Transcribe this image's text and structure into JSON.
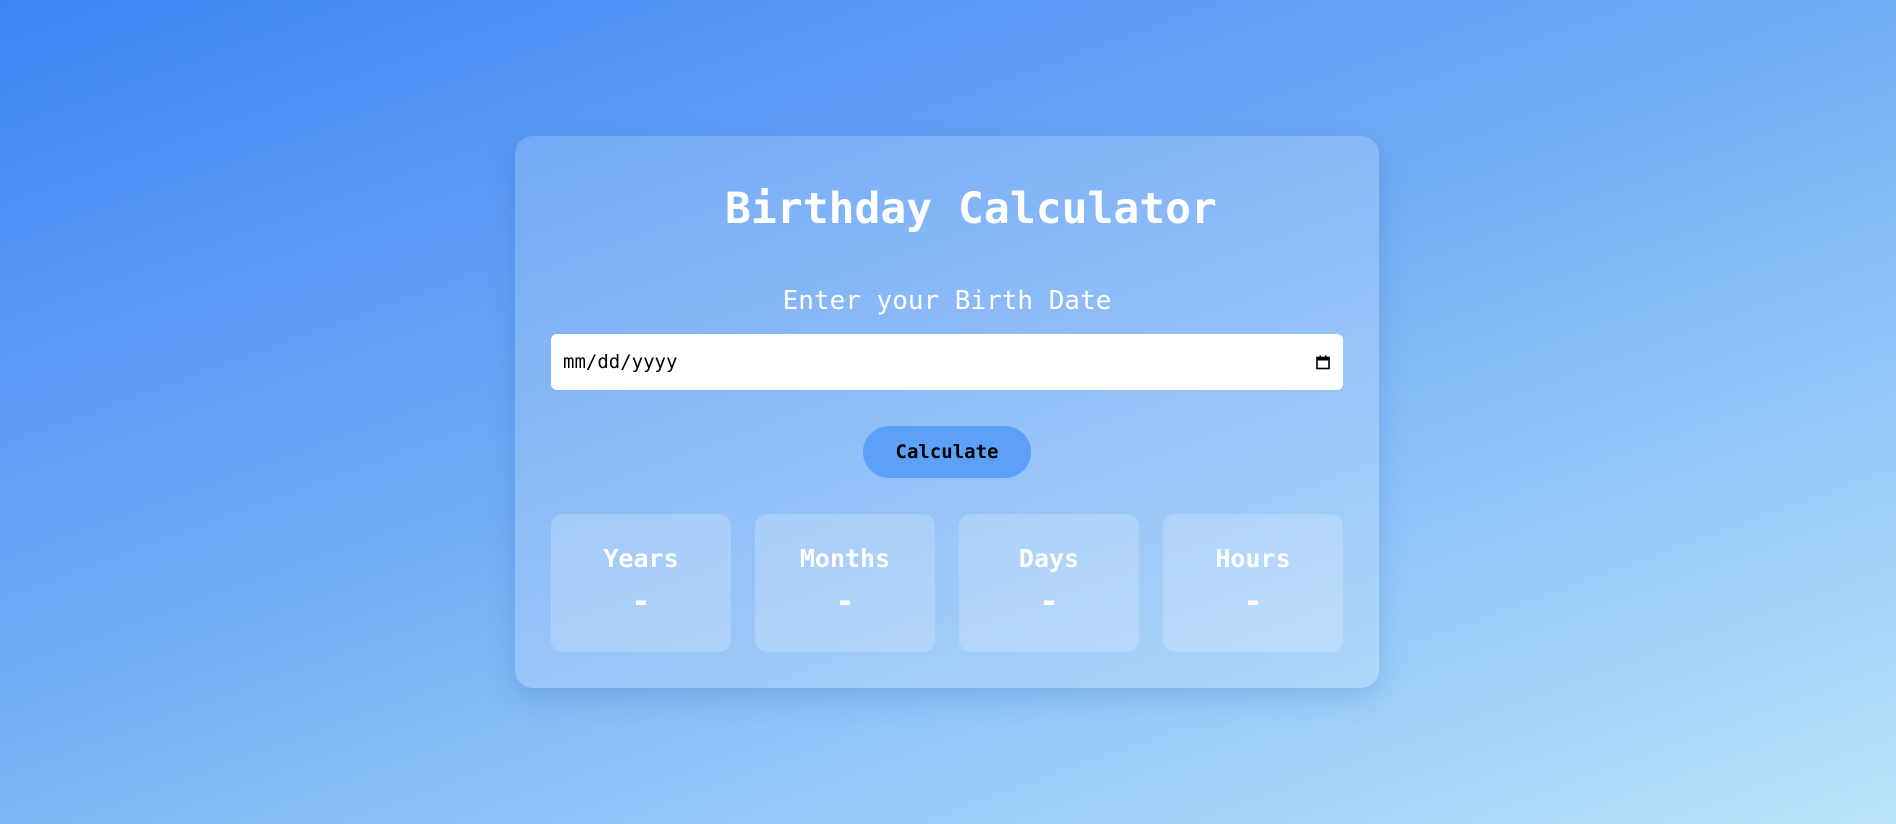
{
  "app": {
    "title": "Birthday Calculator"
  },
  "form": {
    "label": "Enter your Birth Date",
    "date_placeholder": "mm/dd/yyyy",
    "calendar_icon": "calendar-icon",
    "button_label": "Calculate"
  },
  "results": [
    {
      "label": "Years",
      "value": "-"
    },
    {
      "label": "Months",
      "value": "-"
    },
    {
      "label": "Days",
      "value": "-"
    },
    {
      "label": "Hours",
      "value": "-"
    }
  ],
  "colors": {
    "accent": "#5da0f7",
    "text": "#ffffff"
  }
}
